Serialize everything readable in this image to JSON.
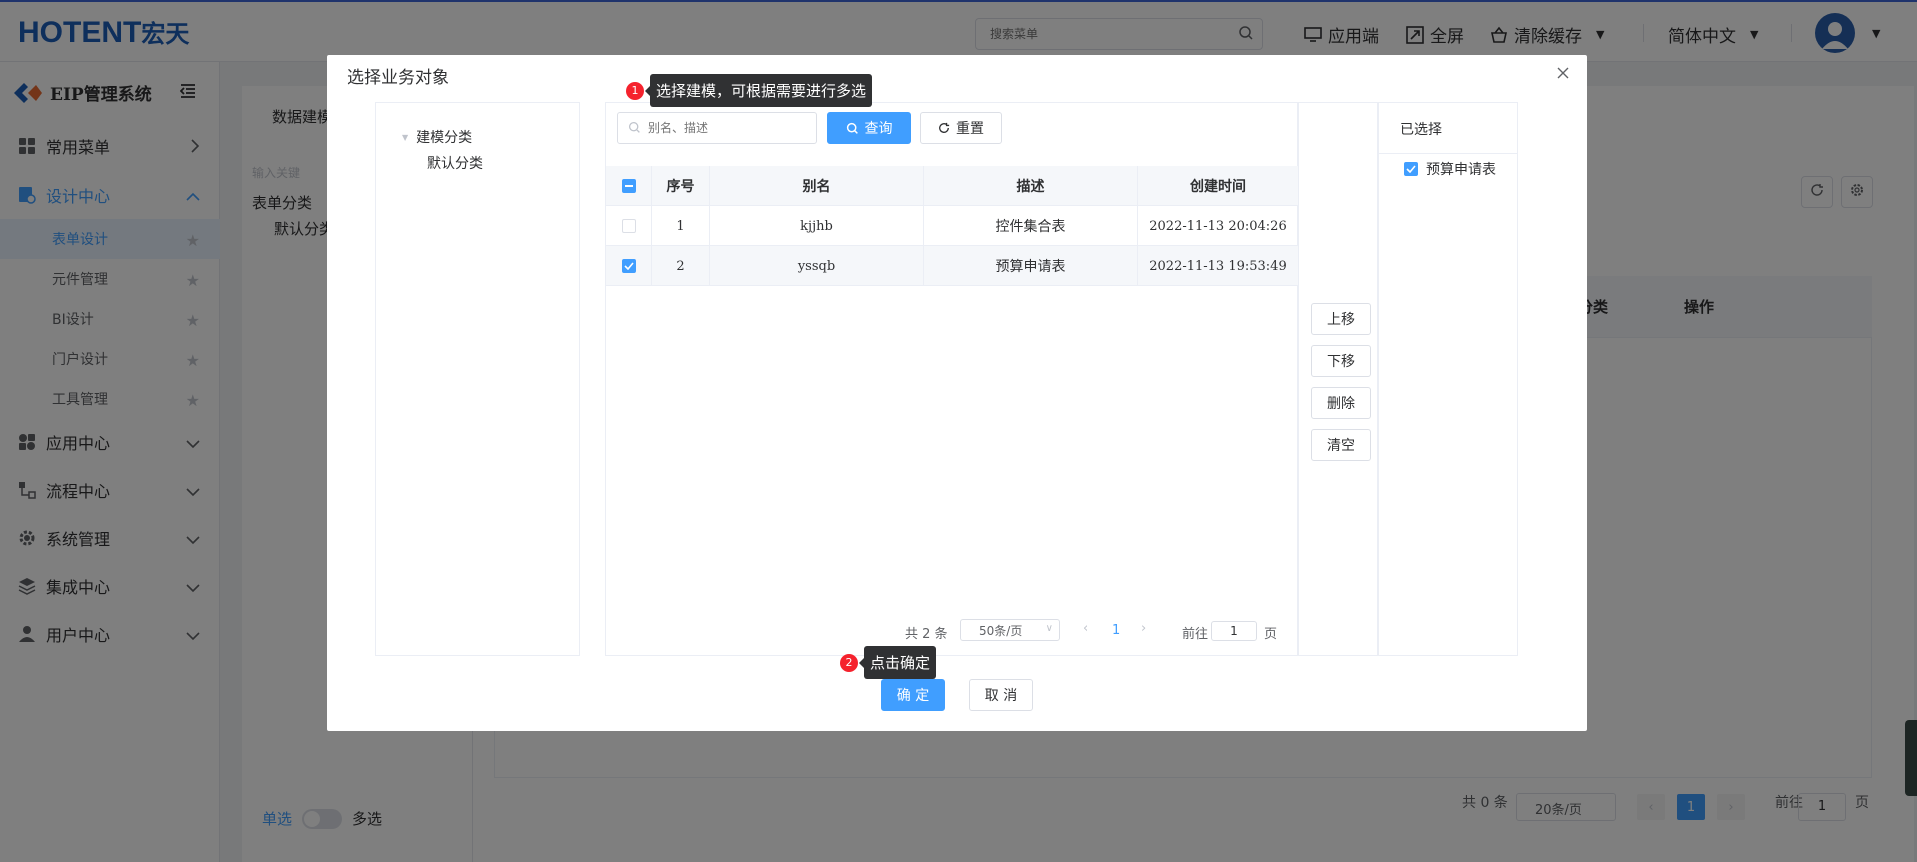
{
  "app": {
    "logo_main": "HOTENT",
    "logo_cn": "宏天",
    "search_placeholder": "搜索菜单",
    "nav": {
      "client": "应用端",
      "fullscreen": "全屏",
      "clear_cache": "清除缓存",
      "language": "简体中文"
    }
  },
  "sidebar": {
    "title": "EIP管理系统",
    "menus": [
      {
        "label": "常用菜单",
        "icon": "grid-icon"
      },
      {
        "label": "设计中心",
        "icon": "design-icon"
      },
      {
        "label": "应用中心",
        "icon": "apps-icon"
      },
      {
        "label": "流程中心",
        "icon": "flow-icon"
      },
      {
        "label": "系统管理",
        "icon": "gear-icon"
      },
      {
        "label": "集成中心",
        "icon": "layers-icon"
      },
      {
        "label": "用户中心",
        "icon": "user-icon"
      }
    ],
    "design_sub": [
      {
        "label": "表单设计"
      },
      {
        "label": "元件管理"
      },
      {
        "label": "BI设计"
      },
      {
        "label": "门户设计"
      },
      {
        "label": "工具管理"
      }
    ]
  },
  "background": {
    "tab": "数据建模",
    "left_search_placeholder": "输入关键",
    "tree_root": "表单分类",
    "tree_child": "默认分类",
    "col_category": "分类",
    "col_action": "操作",
    "pager_total": "共 0 条",
    "pager_size": "20条/页",
    "pager_page": "1",
    "pager_goto_prefix": "前往",
    "pager_goto_value": "1",
    "pager_goto_suffix": "页",
    "mode_single": "单选",
    "mode_multi": "多选"
  },
  "dialog": {
    "title": "选择业务对象",
    "tree_root": "建模分类",
    "tree_child": "默认分类",
    "search_placeholder": "别名、描述",
    "query_label": "查询",
    "reset_label": "重置",
    "columns": [
      "序号",
      "别名",
      "描述",
      "创建时间"
    ],
    "rows": [
      {
        "index": "1",
        "alias": "kjjhb",
        "desc": "控件集合表",
        "created": "2022-11-13 20:04:26",
        "checked": false
      },
      {
        "index": "2",
        "alias": "yssqb",
        "desc": "预算申请表",
        "created": "2022-11-13 19:53:49",
        "checked": true
      }
    ],
    "pager": {
      "total": "共 2 条",
      "size": "50条/页",
      "page": "1",
      "goto_prefix": "前往",
      "goto_value": "1",
      "goto_suffix": "页"
    },
    "side_buttons": [
      "上移",
      "下移",
      "删除",
      "清空"
    ],
    "selected_title": "已选择",
    "selected_items": [
      "预算申请表"
    ],
    "confirm_label": "确 定",
    "cancel_label": "取 消"
  },
  "tips": [
    {
      "num": "1",
      "text": "选择建模，可根据需要进行多选"
    },
    {
      "num": "2",
      "text": "点击确定"
    }
  ],
  "colors": {
    "primary": "#409eff",
    "brand": "#1d5fb8",
    "badge": "#f5222d"
  }
}
